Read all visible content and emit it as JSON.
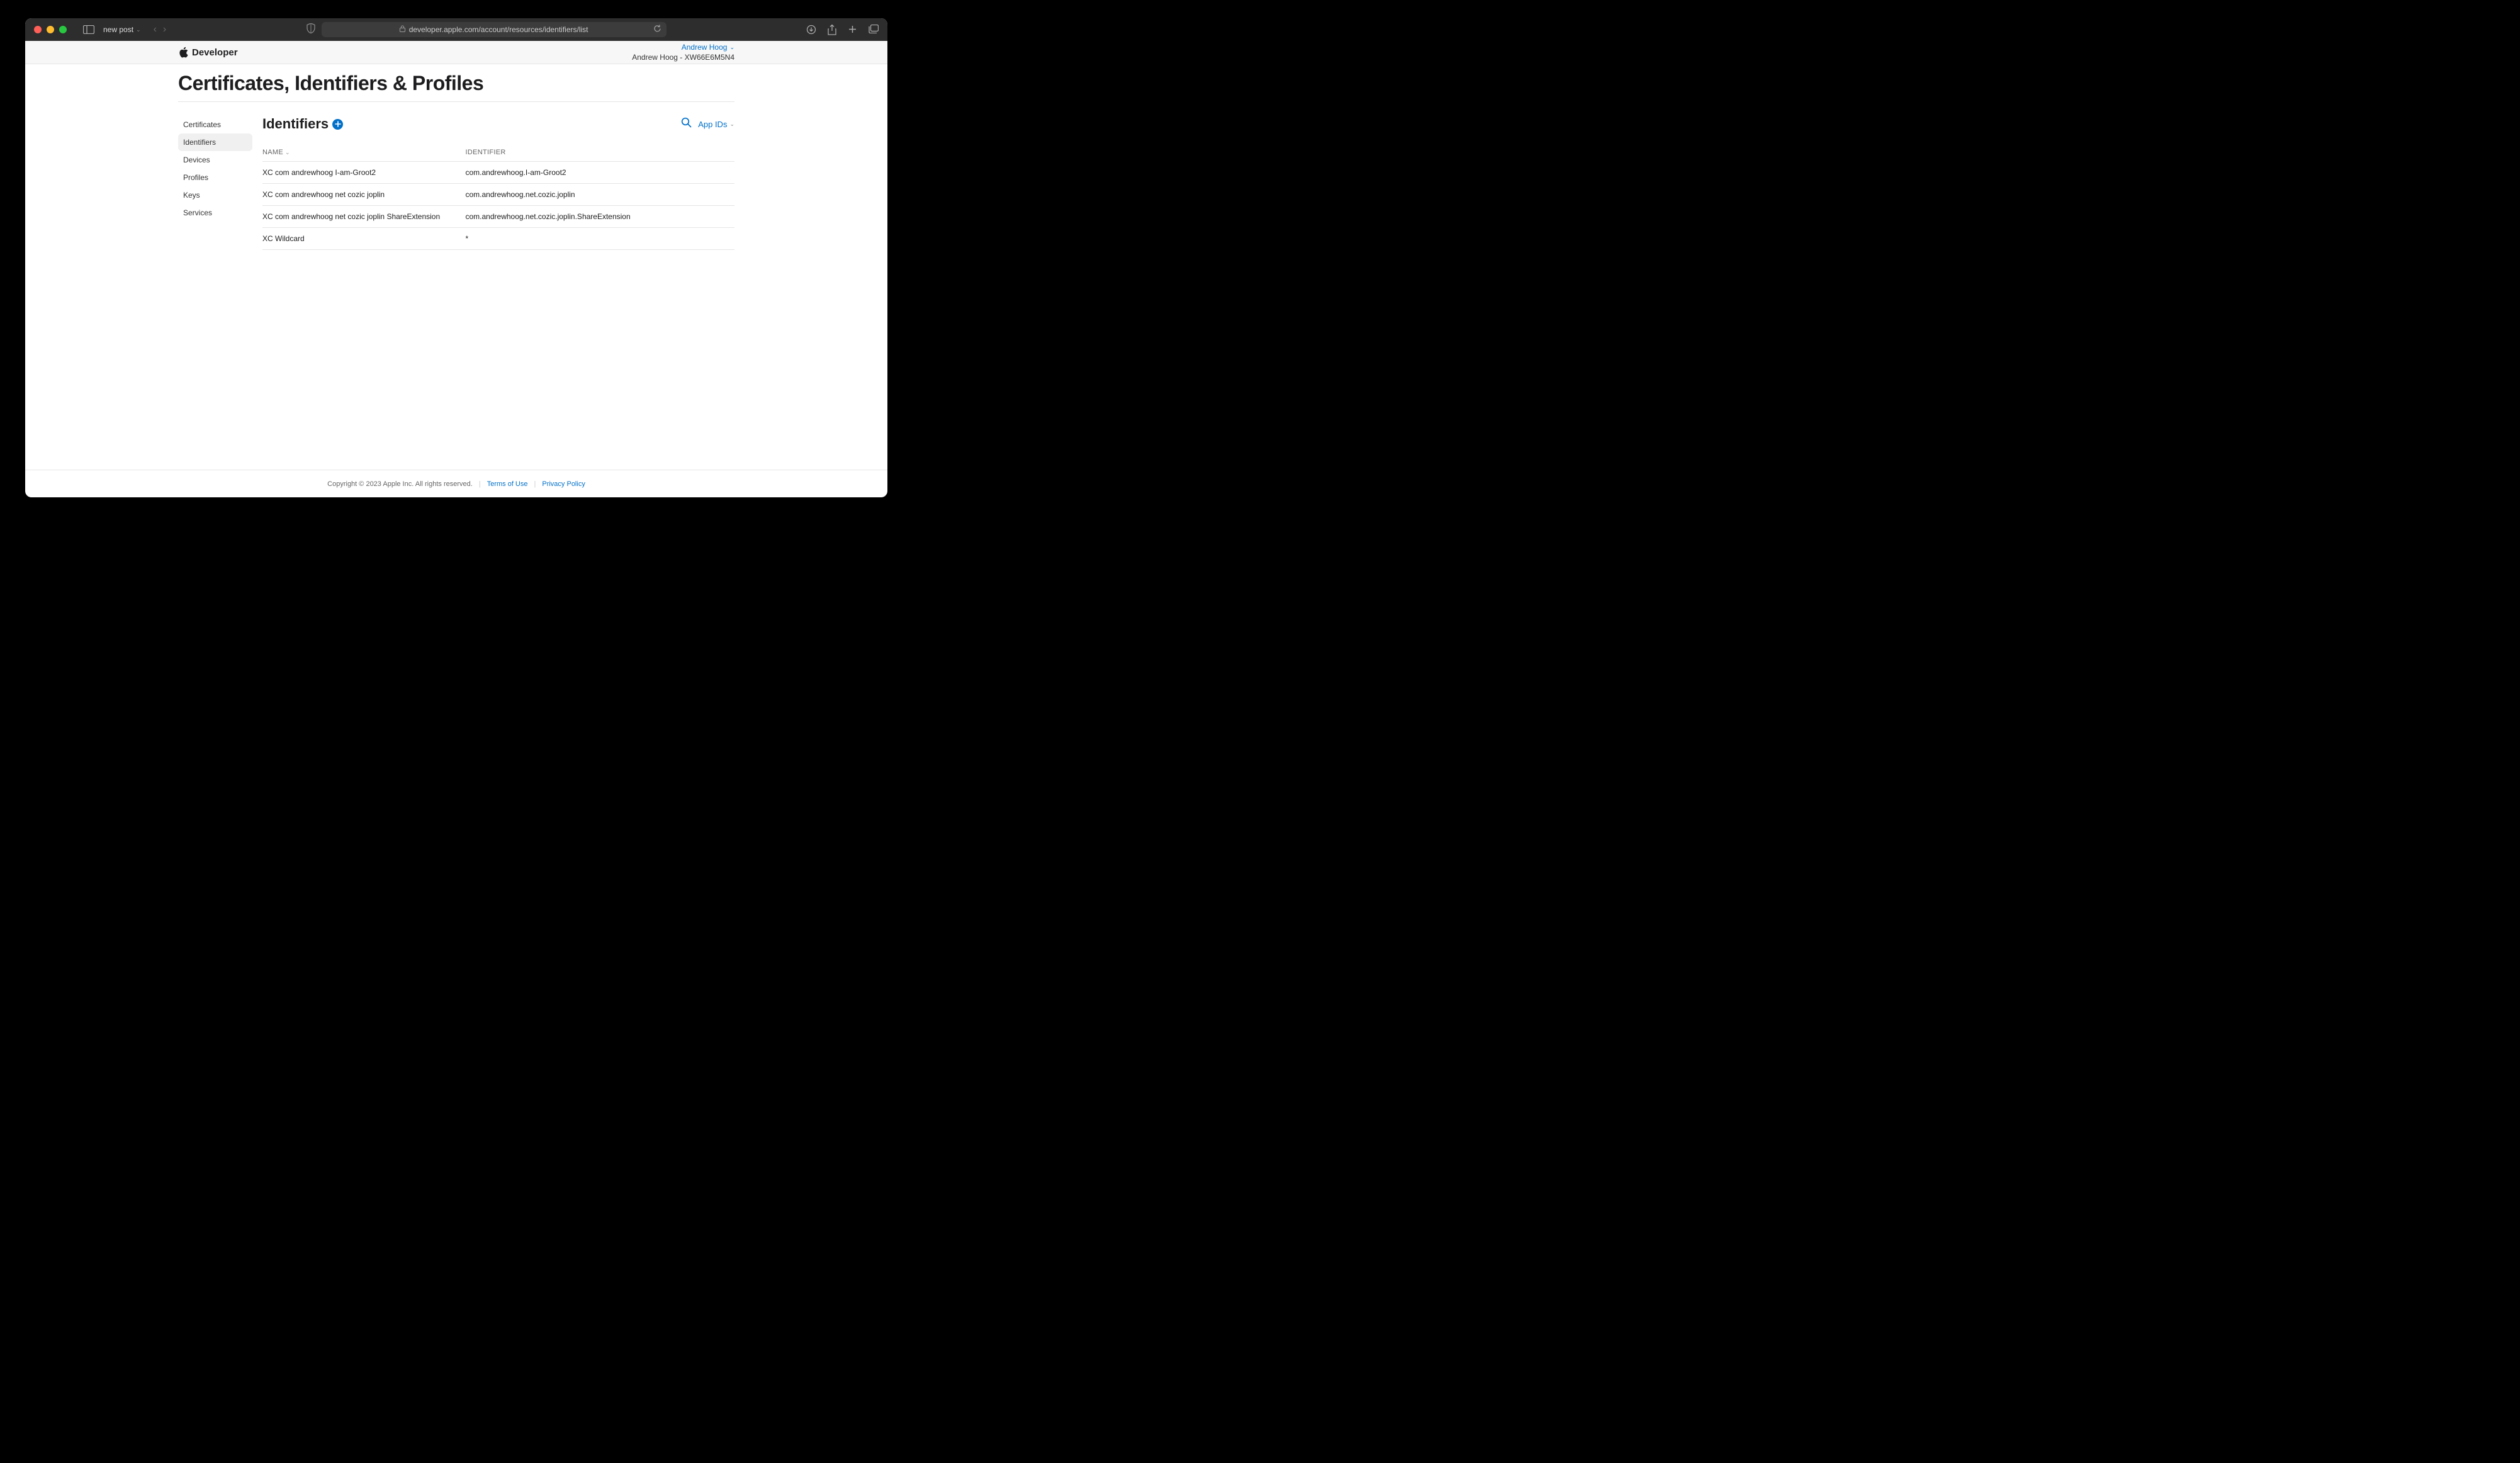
{
  "browser": {
    "tab_title": "new post",
    "url": "developer.apple.com/account/resources/identifiers/list"
  },
  "header": {
    "brand": "Developer",
    "account": {
      "name": "Andrew Hoog",
      "team": "Andrew Hoog - XW66E6M5N4"
    }
  },
  "page_title": "Certificates, Identifiers & Profiles",
  "sidebar": {
    "items": [
      {
        "label": "Certificates",
        "active": false
      },
      {
        "label": "Identifiers",
        "active": true
      },
      {
        "label": "Devices",
        "active": false
      },
      {
        "label": "Profiles",
        "active": false
      },
      {
        "label": "Keys",
        "active": false
      },
      {
        "label": "Services",
        "active": false
      }
    ]
  },
  "main": {
    "section_title": "Identifiers",
    "filter_label": "App IDs",
    "columns": {
      "name": "NAME",
      "identifier": "IDENTIFIER"
    },
    "rows": [
      {
        "name": "XC com andrewhoog I-am-Groot2",
        "identifier": "com.andrewhoog.I-am-Groot2"
      },
      {
        "name": "XC com andrewhoog net cozic joplin",
        "identifier": "com.andrewhoog.net.cozic.joplin"
      },
      {
        "name": "XC com andrewhoog net cozic joplin ShareExtension",
        "identifier": "com.andrewhoog.net.cozic.joplin.ShareExtension"
      },
      {
        "name": "XC Wildcard",
        "identifier": "*"
      }
    ]
  },
  "footer": {
    "copyright": "Copyright © 2023 Apple Inc. All rights reserved.",
    "terms": "Terms of Use",
    "privacy": "Privacy Policy"
  }
}
